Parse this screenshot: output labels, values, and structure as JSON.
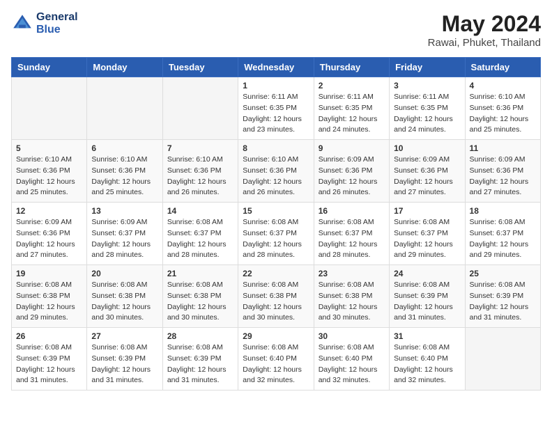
{
  "header": {
    "logo_line1": "General",
    "logo_line2": "Blue",
    "month_title": "May 2024",
    "location": "Rawai, Phuket, Thailand"
  },
  "weekdays": [
    "Sunday",
    "Monday",
    "Tuesday",
    "Wednesday",
    "Thursday",
    "Friday",
    "Saturday"
  ],
  "weeks": [
    [
      {
        "day": "",
        "sunrise": "",
        "sunset": "",
        "daylight": ""
      },
      {
        "day": "",
        "sunrise": "",
        "sunset": "",
        "daylight": ""
      },
      {
        "day": "",
        "sunrise": "",
        "sunset": "",
        "daylight": ""
      },
      {
        "day": "1",
        "sunrise": "Sunrise: 6:11 AM",
        "sunset": "Sunset: 6:35 PM",
        "daylight": "Daylight: 12 hours and 23 minutes."
      },
      {
        "day": "2",
        "sunrise": "Sunrise: 6:11 AM",
        "sunset": "Sunset: 6:35 PM",
        "daylight": "Daylight: 12 hours and 24 minutes."
      },
      {
        "day": "3",
        "sunrise": "Sunrise: 6:11 AM",
        "sunset": "Sunset: 6:35 PM",
        "daylight": "Daylight: 12 hours and 24 minutes."
      },
      {
        "day": "4",
        "sunrise": "Sunrise: 6:10 AM",
        "sunset": "Sunset: 6:36 PM",
        "daylight": "Daylight: 12 hours and 25 minutes."
      }
    ],
    [
      {
        "day": "5",
        "sunrise": "Sunrise: 6:10 AM",
        "sunset": "Sunset: 6:36 PM",
        "daylight": "Daylight: 12 hours and 25 minutes."
      },
      {
        "day": "6",
        "sunrise": "Sunrise: 6:10 AM",
        "sunset": "Sunset: 6:36 PM",
        "daylight": "Daylight: 12 hours and 25 minutes."
      },
      {
        "day": "7",
        "sunrise": "Sunrise: 6:10 AM",
        "sunset": "Sunset: 6:36 PM",
        "daylight": "Daylight: 12 hours and 26 minutes."
      },
      {
        "day": "8",
        "sunrise": "Sunrise: 6:10 AM",
        "sunset": "Sunset: 6:36 PM",
        "daylight": "Daylight: 12 hours and 26 minutes."
      },
      {
        "day": "9",
        "sunrise": "Sunrise: 6:09 AM",
        "sunset": "Sunset: 6:36 PM",
        "daylight": "Daylight: 12 hours and 26 minutes."
      },
      {
        "day": "10",
        "sunrise": "Sunrise: 6:09 AM",
        "sunset": "Sunset: 6:36 PM",
        "daylight": "Daylight: 12 hours and 27 minutes."
      },
      {
        "day": "11",
        "sunrise": "Sunrise: 6:09 AM",
        "sunset": "Sunset: 6:36 PM",
        "daylight": "Daylight: 12 hours and 27 minutes."
      }
    ],
    [
      {
        "day": "12",
        "sunrise": "Sunrise: 6:09 AM",
        "sunset": "Sunset: 6:36 PM",
        "daylight": "Daylight: 12 hours and 27 minutes."
      },
      {
        "day": "13",
        "sunrise": "Sunrise: 6:09 AM",
        "sunset": "Sunset: 6:37 PM",
        "daylight": "Daylight: 12 hours and 28 minutes."
      },
      {
        "day": "14",
        "sunrise": "Sunrise: 6:08 AM",
        "sunset": "Sunset: 6:37 PM",
        "daylight": "Daylight: 12 hours and 28 minutes."
      },
      {
        "day": "15",
        "sunrise": "Sunrise: 6:08 AM",
        "sunset": "Sunset: 6:37 PM",
        "daylight": "Daylight: 12 hours and 28 minutes."
      },
      {
        "day": "16",
        "sunrise": "Sunrise: 6:08 AM",
        "sunset": "Sunset: 6:37 PM",
        "daylight": "Daylight: 12 hours and 28 minutes."
      },
      {
        "day": "17",
        "sunrise": "Sunrise: 6:08 AM",
        "sunset": "Sunset: 6:37 PM",
        "daylight": "Daylight: 12 hours and 29 minutes."
      },
      {
        "day": "18",
        "sunrise": "Sunrise: 6:08 AM",
        "sunset": "Sunset: 6:37 PM",
        "daylight": "Daylight: 12 hours and 29 minutes."
      }
    ],
    [
      {
        "day": "19",
        "sunrise": "Sunrise: 6:08 AM",
        "sunset": "Sunset: 6:38 PM",
        "daylight": "Daylight: 12 hours and 29 minutes."
      },
      {
        "day": "20",
        "sunrise": "Sunrise: 6:08 AM",
        "sunset": "Sunset: 6:38 PM",
        "daylight": "Daylight: 12 hours and 30 minutes."
      },
      {
        "day": "21",
        "sunrise": "Sunrise: 6:08 AM",
        "sunset": "Sunset: 6:38 PM",
        "daylight": "Daylight: 12 hours and 30 minutes."
      },
      {
        "day": "22",
        "sunrise": "Sunrise: 6:08 AM",
        "sunset": "Sunset: 6:38 PM",
        "daylight": "Daylight: 12 hours and 30 minutes."
      },
      {
        "day": "23",
        "sunrise": "Sunrise: 6:08 AM",
        "sunset": "Sunset: 6:38 PM",
        "daylight": "Daylight: 12 hours and 30 minutes."
      },
      {
        "day": "24",
        "sunrise": "Sunrise: 6:08 AM",
        "sunset": "Sunset: 6:39 PM",
        "daylight": "Daylight: 12 hours and 31 minutes."
      },
      {
        "day": "25",
        "sunrise": "Sunrise: 6:08 AM",
        "sunset": "Sunset: 6:39 PM",
        "daylight": "Daylight: 12 hours and 31 minutes."
      }
    ],
    [
      {
        "day": "26",
        "sunrise": "Sunrise: 6:08 AM",
        "sunset": "Sunset: 6:39 PM",
        "daylight": "Daylight: 12 hours and 31 minutes."
      },
      {
        "day": "27",
        "sunrise": "Sunrise: 6:08 AM",
        "sunset": "Sunset: 6:39 PM",
        "daylight": "Daylight: 12 hours and 31 minutes."
      },
      {
        "day": "28",
        "sunrise": "Sunrise: 6:08 AM",
        "sunset": "Sunset: 6:39 PM",
        "daylight": "Daylight: 12 hours and 31 minutes."
      },
      {
        "day": "29",
        "sunrise": "Sunrise: 6:08 AM",
        "sunset": "Sunset: 6:40 PM",
        "daylight": "Daylight: 12 hours and 32 minutes."
      },
      {
        "day": "30",
        "sunrise": "Sunrise: 6:08 AM",
        "sunset": "Sunset: 6:40 PM",
        "daylight": "Daylight: 12 hours and 32 minutes."
      },
      {
        "day": "31",
        "sunrise": "Sunrise: 6:08 AM",
        "sunset": "Sunset: 6:40 PM",
        "daylight": "Daylight: 12 hours and 32 minutes."
      },
      {
        "day": "",
        "sunrise": "",
        "sunset": "",
        "daylight": ""
      }
    ]
  ]
}
